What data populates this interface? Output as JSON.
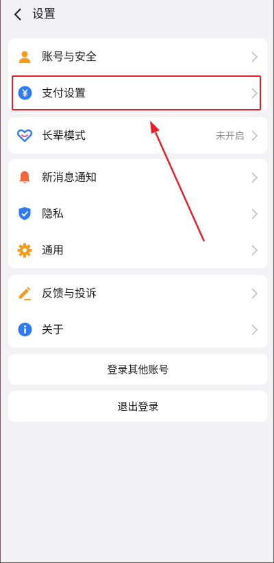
{
  "header": {
    "title": "设置"
  },
  "account_section": {
    "items": [
      {
        "label": "账号与安全"
      },
      {
        "label": "支付设置"
      }
    ]
  },
  "elder_section": {
    "items": [
      {
        "label": "长辈模式",
        "value": "未开启"
      }
    ]
  },
  "general_section": {
    "items": [
      {
        "label": "新消息通知"
      },
      {
        "label": "隐私"
      },
      {
        "label": "通用"
      }
    ]
  },
  "about_section": {
    "items": [
      {
        "label": "反馈与投诉"
      },
      {
        "label": "关于"
      }
    ]
  },
  "actions": {
    "switch_account": "登录其他账号",
    "logout": "退出登录"
  },
  "colors": {
    "annotation_red": "#e0202a",
    "icon_orange": "#f59a1b",
    "icon_blue": "#2f7bf5",
    "icon_bell": "#f2653a"
  }
}
